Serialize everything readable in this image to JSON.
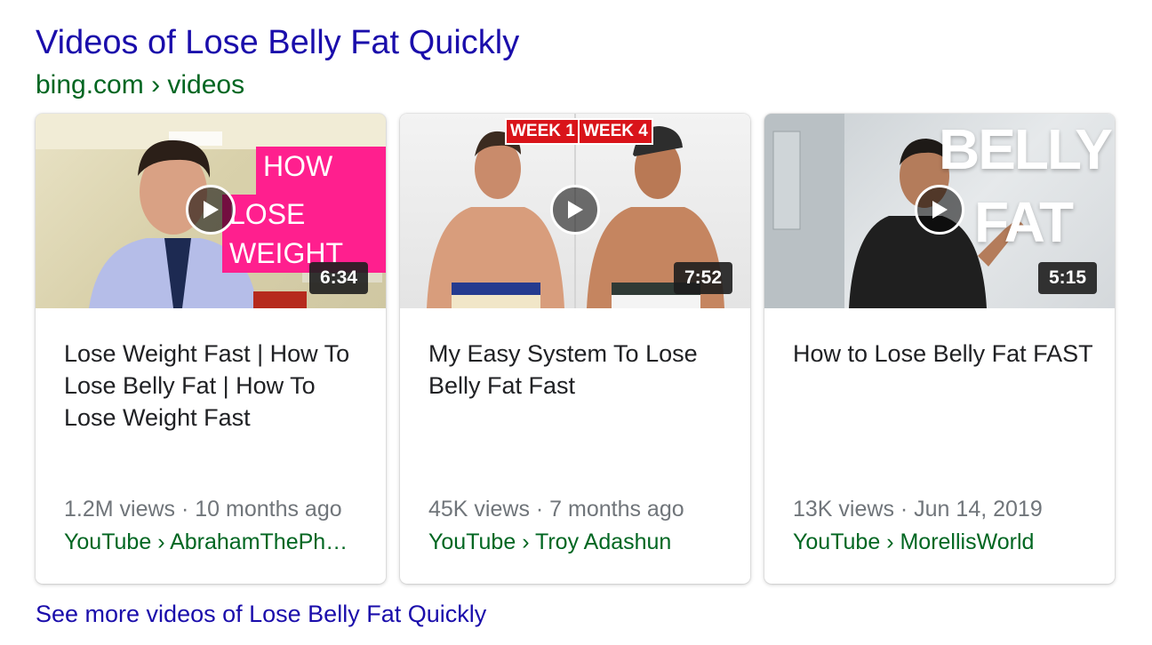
{
  "heading": "Videos of Lose Belly Fat Quickly",
  "source": "bing.com › videos",
  "cards": [
    {
      "duration": "6:34",
      "title": "Lose Weight Fast | How To Lose Belly Fat | How To Lose Weight Fast",
      "meta": "1.2M views · 10 months ago",
      "channel": "YouTube › AbrahamThePh…",
      "thumb_text": [
        "HOW TO",
        "LOSE WEIGHT"
      ]
    },
    {
      "duration": "7:52",
      "title": "My Easy System To Lose Belly Fat Fast",
      "meta": "45K views · 7 months ago",
      "channel": "YouTube › Troy Adashun",
      "thumb_text": [
        "WEEK 1",
        "WEEK 4"
      ]
    },
    {
      "duration": "5:15",
      "title": "How to Lose Belly Fat FAST",
      "meta": "13K views · Jun 14, 2019",
      "channel": "YouTube › MorellisWorld",
      "thumb_text": [
        "BELLY",
        "FAT"
      ]
    }
  ],
  "see_more": "See more videos of Lose Belly Fat Quickly",
  "colors": {
    "link": "#1a0dab",
    "url_green": "#006621",
    "meta_gray": "#70757a",
    "thumb_pink": "#ff1f8e",
    "week_red": "#d9141a"
  },
  "icons": {
    "play": "play-icon"
  }
}
